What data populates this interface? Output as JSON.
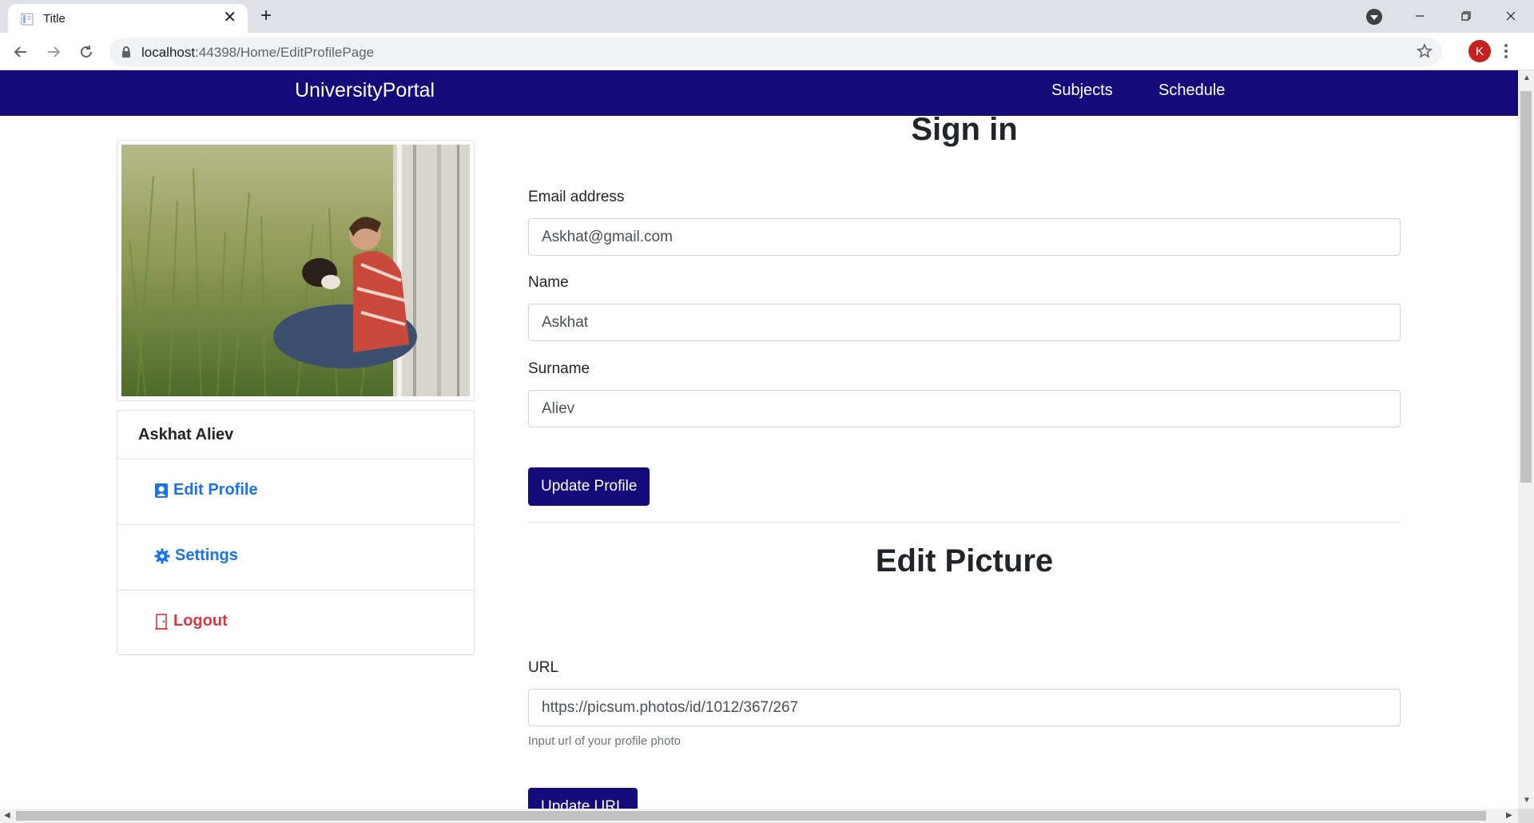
{
  "browser": {
    "tab_title": "Title",
    "tab_close": "✕",
    "new_tab": "+",
    "url_host": "localhost",
    "url_rest": ":44398/Home/EditProfilePage",
    "profile_initial": "K"
  },
  "navbar": {
    "brand": "UniversityPortal",
    "links": [
      "Subjects",
      "Schedule"
    ],
    "background": "#150a7a"
  },
  "sidebar": {
    "user_name": "Askhat Aliev",
    "items": [
      {
        "label": "Edit Profile",
        "icon": "person-badge-icon",
        "color": "#1a73e8"
      },
      {
        "label": "Settings",
        "icon": "gear-icon",
        "color": "#1a73e8"
      },
      {
        "label": "Logout",
        "icon": "door-icon",
        "color": "#dc3545"
      }
    ]
  },
  "profile_form": {
    "title": "Sign in",
    "email_label": "Email address",
    "email_value": "Askhat@gmail.com",
    "name_label": "Name",
    "name_value": "Askhat",
    "surname_label": "Surname",
    "surname_value": "Aliev",
    "submit_label": "Update Profile"
  },
  "picture_form": {
    "title": "Edit Picture",
    "url_label": "URL",
    "url_value": "https://picsum.photos/id/1012/367/267",
    "help_text": "Input url of your profile photo",
    "submit_label": "Update URL"
  }
}
